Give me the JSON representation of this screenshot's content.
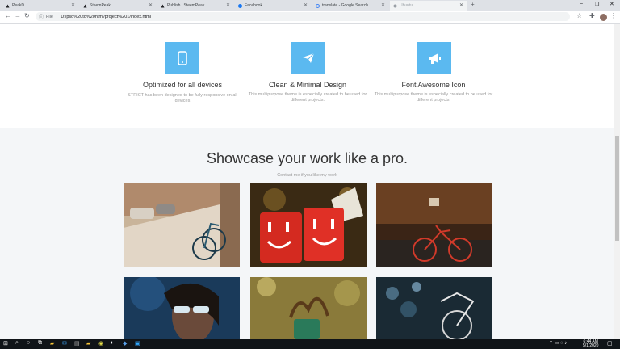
{
  "browser": {
    "tabs": [
      {
        "title": "PeakD",
        "icon": "peakd-icon"
      },
      {
        "title": "SteemPeak",
        "icon": "steempeak-icon"
      },
      {
        "title": "Publish | SteemPeak",
        "icon": "steempeak-icon"
      },
      {
        "title": "Facebook",
        "icon": "facebook-icon"
      },
      {
        "title": "translate - Google Search",
        "icon": "google-icon"
      },
      {
        "title": "Ubuntu",
        "icon": "globe-icon"
      }
    ],
    "url_scheme_label": "File",
    "url": "D:/psd%20to%20html/project%201/index.html"
  },
  "features": [
    {
      "title": "Optimized for all devices",
      "desc": "STRICT has been designed to be fully responsive on all devices",
      "icon": "mobile-icon"
    },
    {
      "title": "Clean & Minimal Design",
      "desc": "This multipurpose theme is especially created to be used for different projects.",
      "icon": "paper-plane-icon"
    },
    {
      "title": "Font Awesome Icon",
      "desc": "This multipurpose theme is especially created to be used for different projects.",
      "icon": "megaphone-icon"
    }
  ],
  "showcase": {
    "title": "Showcase your work like a pro.",
    "subtitle": "Contact me if you like my work"
  },
  "taskbar": {
    "time": "6:44 AM",
    "date": "5/1/2020"
  },
  "colors": {
    "feature_icon_bg": "#5bb9f0",
    "page_bg": "#f4f6f8",
    "taskbar_bg": "#101418"
  }
}
